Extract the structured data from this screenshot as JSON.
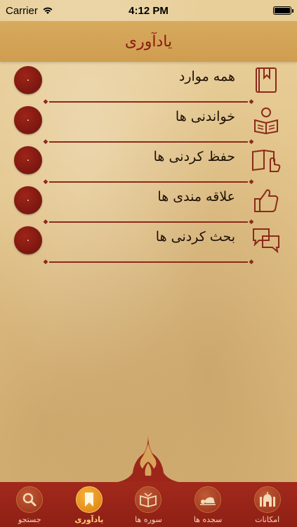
{
  "status": {
    "carrier": "Carrier",
    "time": "4:12 PM"
  },
  "nav": {
    "title": "یادآوری"
  },
  "rows": [
    {
      "label": "همه موارد",
      "count": "۰",
      "icon": "bookmark-book-icon"
    },
    {
      "label": "خواندنی ها",
      "count": "۰",
      "icon": "reading-person-icon"
    },
    {
      "label": "حفظ کردنی ها",
      "count": "۰",
      "icon": "book-hand-icon"
    },
    {
      "label": "علاقه مندی ها",
      "count": "۰",
      "icon": "thumbs-up-icon"
    },
    {
      "label": "بحث کردنی ها",
      "count": "۰",
      "icon": "chat-bubbles-icon"
    }
  ],
  "tabs": [
    {
      "label": "جستجو",
      "icon": "search-icon",
      "active": false
    },
    {
      "label": "یادآوری",
      "icon": "bookmark-icon",
      "active": true
    },
    {
      "label": "سوره ها",
      "icon": "quran-icon",
      "active": false
    },
    {
      "label": "سجده ها",
      "icon": "prostration-icon",
      "active": false
    },
    {
      "label": "امکانات",
      "icon": "mosque-icon",
      "active": false
    }
  ],
  "colors": {
    "accent": "#8b1a12",
    "badge": "#8f1e14",
    "tab_bar": "#9b2619",
    "active_tab": "#f0a02a",
    "parchment": "#e3c48a"
  }
}
